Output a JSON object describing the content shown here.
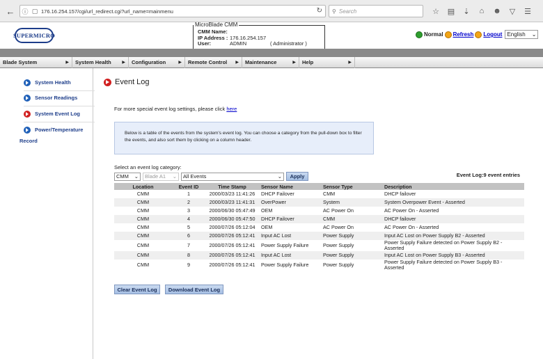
{
  "browser": {
    "url": "176.16.254.157/cgi/url_redirect.cgi?url_name=mainmenu",
    "search_placeholder": "Search"
  },
  "header": {
    "logo_text": "SUPERMICRO",
    "info_title": "MicroBlade CMM",
    "cmm_name_label": "CMM Name:",
    "cmm_name_value": "",
    "ip_label": "IP Address :",
    "ip_value": "176.16.254.157",
    "user_label": "User:",
    "user_value": "ADMIN",
    "user_role": "( Administrator )",
    "status_normal": "Normal",
    "refresh": "Refresh",
    "logout": "Logout",
    "language": "English"
  },
  "menu": [
    {
      "label": "Blade System"
    },
    {
      "label": "System Health"
    },
    {
      "label": "Configuration"
    },
    {
      "label": "Remote Control"
    },
    {
      "label": "Maintenance"
    },
    {
      "label": "Help"
    }
  ],
  "sidebar": {
    "items": [
      {
        "label": "System Health"
      },
      {
        "label": "Sensor Readings"
      },
      {
        "label": "System Event Log"
      },
      {
        "label": "Power/Temperature"
      }
    ],
    "sub_label": "Record"
  },
  "main": {
    "title": "Event Log",
    "more_text": "For more special event log settings, please click ",
    "more_link": "here",
    "info_text": "Below is a table of the events from the system's event log. You can choose a category from the pull-down box to filter the events, and also sort them by clicking on a column header.",
    "category_label": "Select an event log category:",
    "filter_device": "CMM",
    "filter_blade": "Blade A1",
    "filter_events": "All Events",
    "apply_label": "Apply",
    "entries_text": "Event Log:9 event entries",
    "columns": [
      "Location",
      "Event ID",
      "Time Stamp",
      "Sensor Name",
      "Sensor Type",
      "Description"
    ],
    "rows": [
      {
        "loc": "CMM",
        "id": "1",
        "ts": "2000/03/23 11:41:26",
        "name": "DHCP Failover",
        "type": "CMM",
        "desc": "DHCP failover"
      },
      {
        "loc": "CMM",
        "id": "2",
        "ts": "2000/03/23 11:41:31",
        "name": "OverPower",
        "type": "System",
        "desc": "System Overpower Event - Asserted"
      },
      {
        "loc": "CMM",
        "id": "3",
        "ts": "2000/06/30 05:47:49",
        "name": "OEM",
        "type": "AC Power On",
        "desc": "AC Power On - Asserted"
      },
      {
        "loc": "CMM",
        "id": "4",
        "ts": "2000/06/30 05:47:50",
        "name": "DHCP Failover",
        "type": "CMM",
        "desc": "DHCP failover"
      },
      {
        "loc": "CMM",
        "id": "5",
        "ts": "2000/07/26 05:12:04",
        "name": "OEM",
        "type": "AC Power On",
        "desc": "AC Power On - Asserted"
      },
      {
        "loc": "CMM",
        "id": "6",
        "ts": "2000/07/26 05:12:41",
        "name": "Input AC Lost",
        "type": "Power Supply",
        "desc": "Input AC Lost on Power Supply B2 - Asserted"
      },
      {
        "loc": "CMM",
        "id": "7",
        "ts": "2000/07/26 05:12:41",
        "name": "Power Supply Failure",
        "type": "Power Supply",
        "desc": "Power Supply Failure detected on Power Supply B2 - Asserted"
      },
      {
        "loc": "CMM",
        "id": "8",
        "ts": "2000/07/26 05:12:41",
        "name": "Input AC Lost",
        "type": "Power Supply",
        "desc": "Input AC Lost on Power Supply B3 - Asserted"
      },
      {
        "loc": "CMM",
        "id": "9",
        "ts": "2000/07/26 05:12:41",
        "name": "Power Supply Failure",
        "type": "Power Supply",
        "desc": "Power Supply Failure detected on Power Supply B3 - Asserted"
      }
    ],
    "clear_label": "Clear Event Log",
    "download_label": "Download Event Log"
  }
}
